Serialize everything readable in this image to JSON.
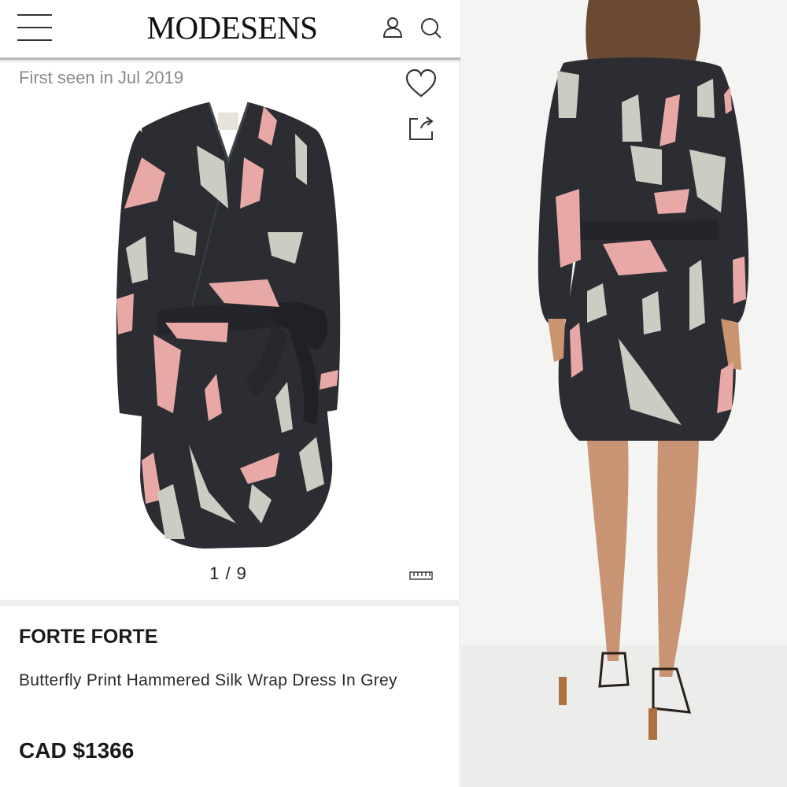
{
  "header": {
    "logo": "MODESENS",
    "menu_icon": "hamburger-menu-icon",
    "account_icon": "user-icon",
    "search_icon": "search-icon"
  },
  "product": {
    "first_seen": "First seen in Jul 2019",
    "pager": "1 / 9",
    "brand": "FORTE FORTE",
    "name": "Butterfly Print Hammered Silk Wrap Dress In Grey",
    "price": "CAD $1366"
  },
  "icons": {
    "wishlist": "heart-icon",
    "share": "share-icon",
    "size_guide": "ruler-icon"
  },
  "colors": {
    "dress": "#2b2d33",
    "butterfly_pink": "#e8a9a6",
    "butterfly_grey": "#c9cdc2",
    "backdrop": "#f4f4f2",
    "text": "#1a1a1a",
    "muted": "#8a8a8a"
  }
}
